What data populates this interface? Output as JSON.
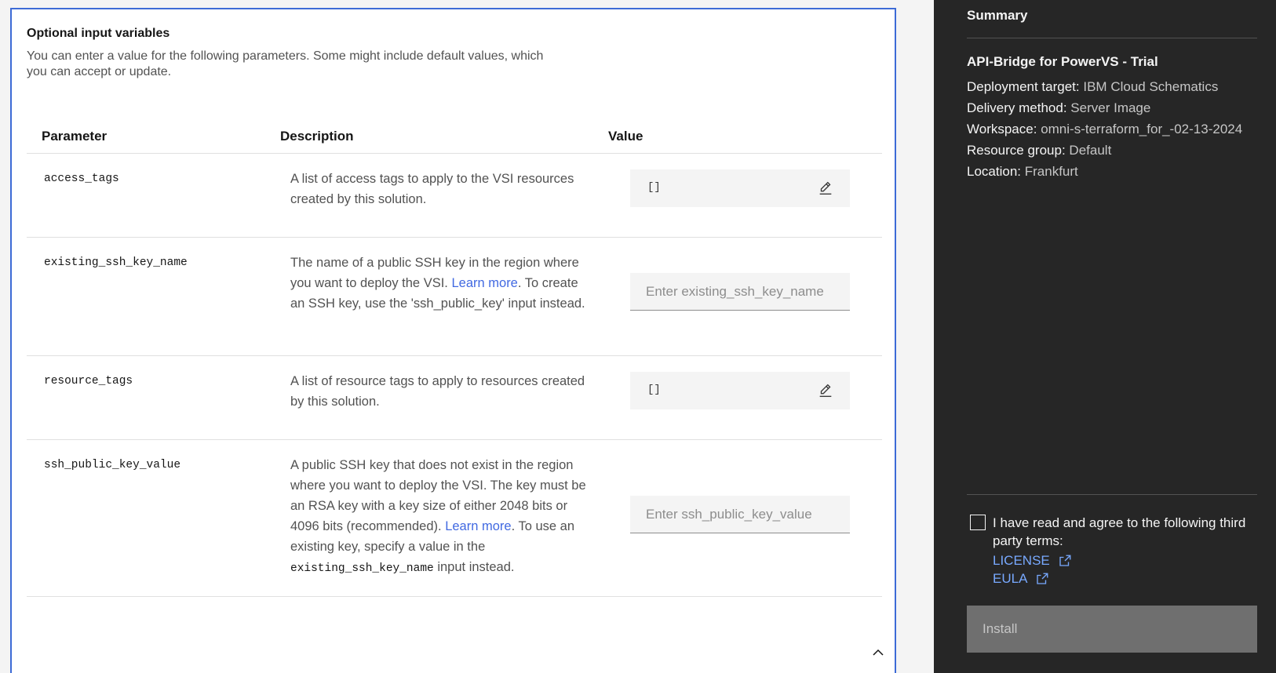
{
  "section": {
    "title": "Optional input variables",
    "description": "You can enter a value for the following parameters. Some might include default values, which you can accept or update."
  },
  "table": {
    "headers": {
      "parameter": "Parameter",
      "description": "Description",
      "value": "Value"
    },
    "rows": [
      {
        "param": "access_tags",
        "description": "A list of access tags to apply to the VSI resources created by this solution.",
        "value": "[]",
        "value_type": "editable-list"
      },
      {
        "param": "existing_ssh_key_name",
        "description_pre": "The name of a public SSH key in the region where you want to deploy the VSI.",
        "link": "Learn more",
        "description_post": ". To create an SSH key, use the 'ssh_public_key' input instead.",
        "placeholder": "Enter existing_ssh_key_name",
        "value_type": "text-input"
      },
      {
        "param": "resource_tags",
        "description": "A list of resource tags to apply to resources created by this solution.",
        "value": "[]",
        "value_type": "editable-list"
      },
      {
        "param": "ssh_public_key_value",
        "description_pre": "A public SSH key that does not exist in the region where you want to deploy the VSI. The key must be an RSA key with a key size of either 2048 bits or 4096 bits (recommended).",
        "link": "Learn more",
        "description_mid": ". To use an existing key, specify a value in the",
        "code": "existing_ssh_key_name",
        "description_post": "input instead.",
        "placeholder": "Enter ssh_public_key_value",
        "value_type": "text-input"
      }
    ]
  },
  "summary": {
    "title": "Summary",
    "product": "API-Bridge for PowerVS - Trial",
    "items": [
      {
        "label": "Deployment target:",
        "value": "IBM Cloud Schematics"
      },
      {
        "label": "Delivery method:",
        "value": "Server Image"
      },
      {
        "label": "Workspace:",
        "value": "omni-s-terraform_for_-02-13-2024"
      },
      {
        "label": "Resource group:",
        "value": "Default"
      },
      {
        "label": "Location:",
        "value": "Frankfurt"
      }
    ],
    "agree_text": "I have read and agree to the following third party terms:",
    "terms": [
      "LICENSE",
      "EULA"
    ],
    "install_label": "Install",
    "install_enabled": false,
    "agree_checked": false
  },
  "colors": {
    "accent_border": "#3d6bd6",
    "link": "#4169e1",
    "sidebar_bg": "#262626",
    "sidebar_link": "#78a9ff"
  }
}
